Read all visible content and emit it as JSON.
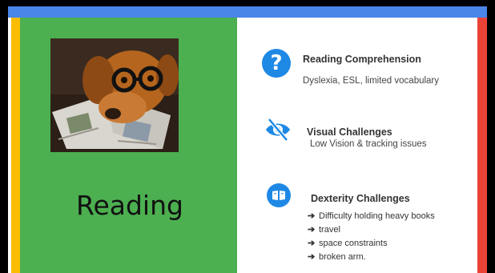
{
  "slide": {
    "title": "Reading",
    "photo_alt": "dog wearing glasses reading a magazine",
    "colors": {
      "blue": "#4a86e8",
      "yellow": "#fbbc04",
      "green": "#4caf50",
      "red": "#ea4335",
      "icon_blue": "#1e88e5"
    }
  },
  "sections": [
    {
      "icon": "question-mark-icon",
      "title": "Reading Comprehension",
      "text": "Dyslexia, ESL, limited vocabulary"
    },
    {
      "icon": "eye-slash-icon",
      "title": "Visual Challenges",
      "text": "Low Vision & tracking issues"
    },
    {
      "icon": "book-icon",
      "title": "Dexterity Challenges",
      "items": [
        "Difficulty holding heavy books",
        "travel",
        "space constraints",
        "broken arm."
      ]
    }
  ],
  "icons": {
    "question": "?",
    "arrow": "➔"
  }
}
